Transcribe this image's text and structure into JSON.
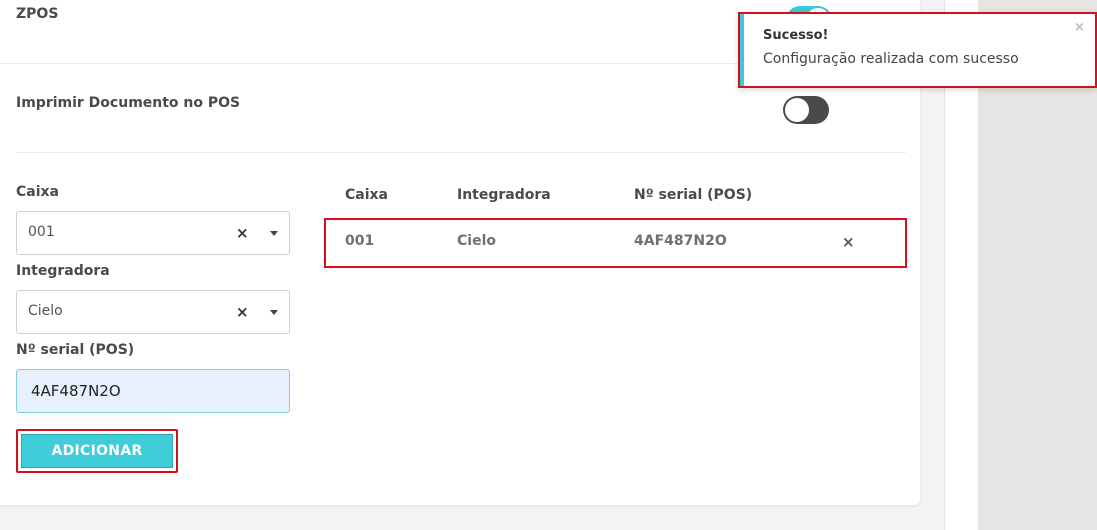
{
  "zpos": {
    "title": "ZPOS",
    "toggle_on": true
  },
  "imprimir": {
    "title": "Imprimir Documento no POS",
    "toggle_on": false
  },
  "form": {
    "caixa_label": "Caixa",
    "caixa_value": "001",
    "integradora_label": "Integradora",
    "integradora_value": "Cielo",
    "serial_label": "Nº serial (POS)",
    "serial_value": "4AF487N2O",
    "clear_icon": "×",
    "add_button": "ADICIONAR"
  },
  "table": {
    "headers": [
      "Caixa",
      "Integradora",
      "Nº serial (POS)"
    ],
    "rows": [
      {
        "caixa": "001",
        "integradora": "Cielo",
        "serial": "4AF487N2O",
        "delete_icon": "×"
      }
    ]
  },
  "toast": {
    "title": "Sucesso!",
    "message": "Configuração realizada com sucesso",
    "close_icon": "×"
  },
  "colors": {
    "accent": "#3ec7d6",
    "highlight": "#d0101a"
  }
}
